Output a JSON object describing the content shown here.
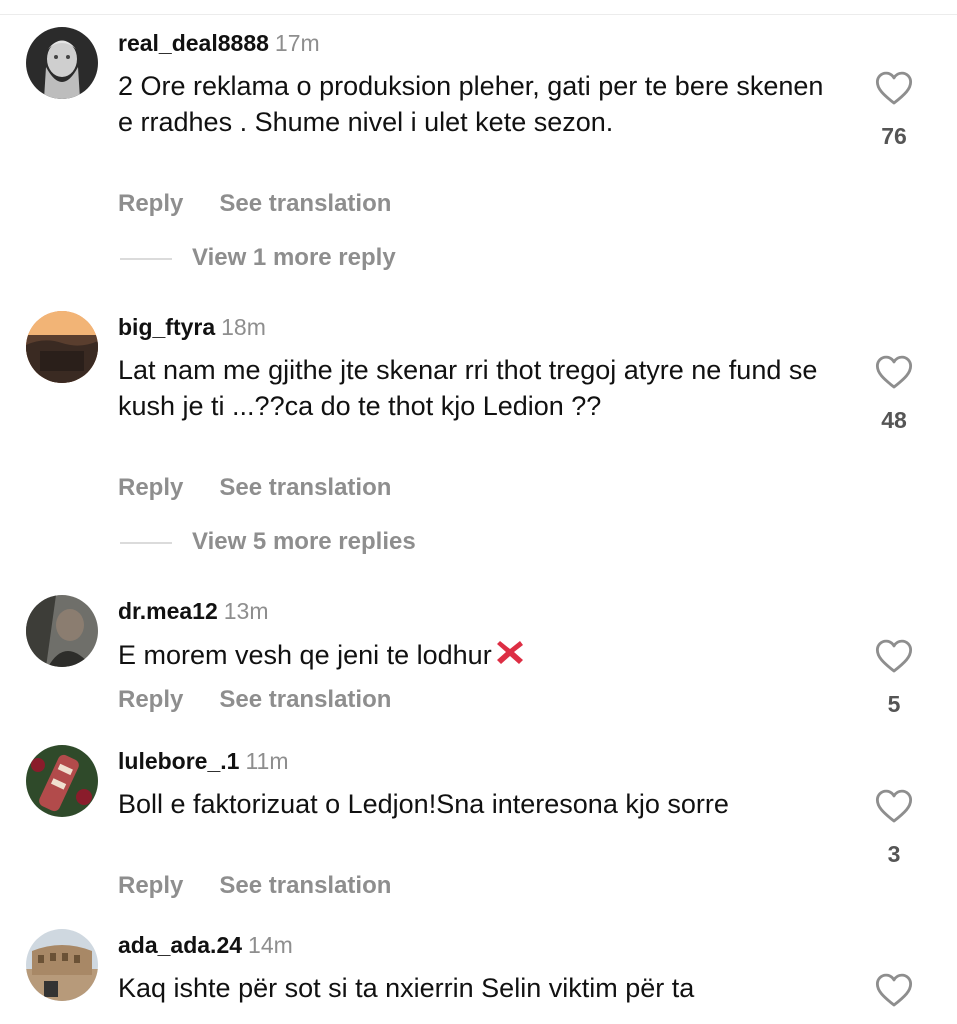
{
  "comments": [
    {
      "username": "real_deal8888",
      "time": "17m",
      "text": "2 Ore reklama o produksion pleher, gati per te bere skenen e rradhes . Shume nivel i ulet kete sezon.",
      "reply_label": "Reply",
      "translate_label": "See translation",
      "likes": "76",
      "view_more": "View 1 more reply"
    },
    {
      "username": "big_ftyra",
      "time": "18m",
      "text": "Lat nam me gjithe jte skenar rri thot tregoj atyre ne fund se kush je ti ...??ca do te thot kjo Ledion ??",
      "reply_label": "Reply",
      "translate_label": "See translation",
      "likes": "48",
      "view_more": "View 5 more replies"
    },
    {
      "username": "dr.mea12",
      "time": "13m",
      "text": "E morem vesh qe jeni te lodhur",
      "text_emoji": "cross-mark-emoji",
      "reply_label": "Reply",
      "translate_label": "See translation",
      "likes": "5"
    },
    {
      "username": "lulebore_.1",
      "time": "11m",
      "text": "Boll e faktorizuat o Ledjon!Sna interesona kjo sorre",
      "reply_label": "Reply",
      "translate_label": "See translation",
      "likes": "3"
    },
    {
      "username": "ada_ada.24",
      "time": "14m",
      "text": "Kaq ishte për sot si ta nxierrin Selin viktim për ta"
    }
  ],
  "colors": {
    "text": "#111111",
    "muted": "#8e8e8e",
    "divider": "#dbdbdb",
    "emoji_red": "#dd2e44"
  },
  "icons": {
    "like": "heart-outline-icon"
  }
}
